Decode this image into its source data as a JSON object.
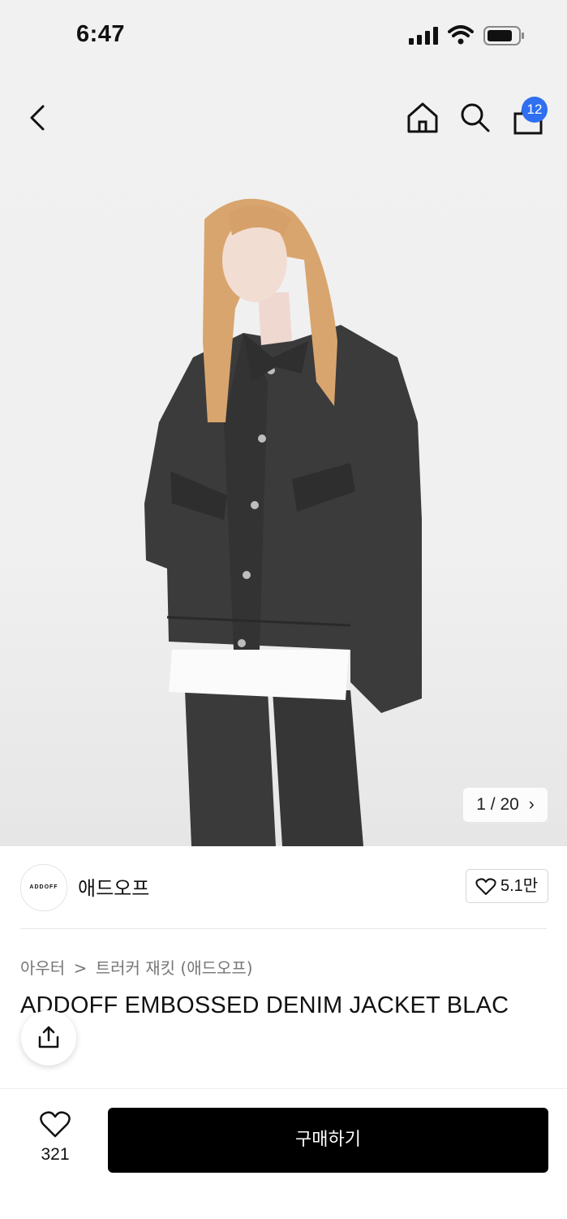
{
  "status_bar": {
    "time": "6:47"
  },
  "header": {
    "cart_count": "12"
  },
  "gallery": {
    "counter": "1 / 20"
  },
  "brand": {
    "logo_text": "ADDOFF",
    "name": "애드오프",
    "likes": "5.1만"
  },
  "breadcrumb": {
    "category": "아우터",
    "separator": ">",
    "subcategory": "트러커 재킷 (애드오프)"
  },
  "product": {
    "title": "ADDOFF EMBOSSED DENIM JACKET BLAC"
  },
  "bottom_bar": {
    "wish_count": "321",
    "buy_label": "구매하기"
  },
  "colors": {
    "badge": "#2f6ff0",
    "buy_button": "#000000"
  }
}
